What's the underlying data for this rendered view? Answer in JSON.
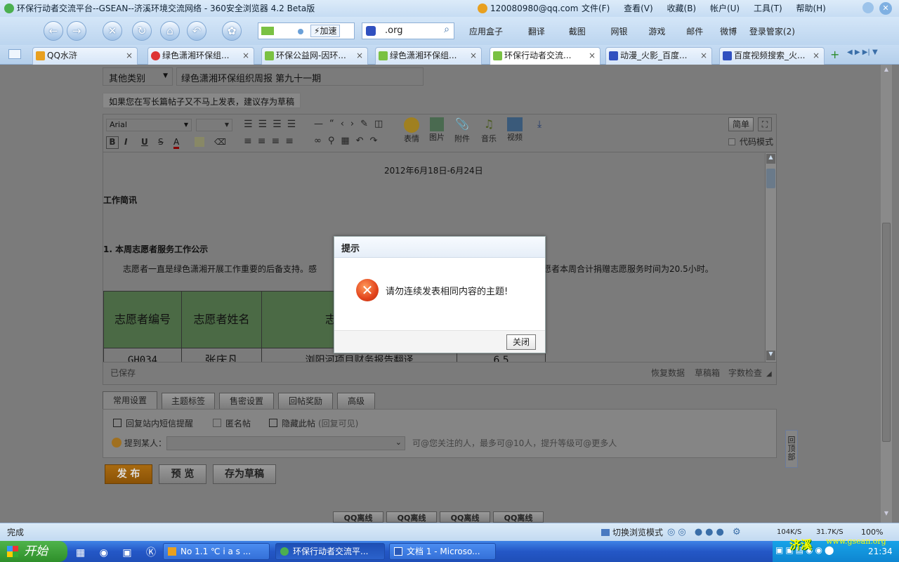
{
  "window": {
    "title": "环保行动者交流平台--GSEAN--济溪环境交流网络 - 360安全浏览器 4.2 Beta版",
    "account": "120080980@qq.com",
    "menu": [
      "文件(F)",
      "查看(V)",
      "收藏(B)",
      "帐户(U)",
      "工具(T)",
      "帮助(H)"
    ]
  },
  "toolbar": {
    "speed_label": "加速",
    "address_value": ".org",
    "links": [
      "应用盒子",
      "翻译",
      "截图",
      "网银",
      "游戏",
      "邮件",
      "微博",
      "登录管家(2)"
    ]
  },
  "tabs": [
    {
      "label": "QQ水浒"
    },
    {
      "label": "绿色潇湘环保组..."
    },
    {
      "label": "环保公益网-因环..."
    },
    {
      "label": "绿色潇湘环保组..."
    },
    {
      "label": "环保行动者交流..."
    },
    {
      "label": "动漫_火影_百度..."
    },
    {
      "label": "百度视频搜索_火..."
    }
  ],
  "form": {
    "category": "其他类别",
    "subject": "绿色潇湘环保组织周报 第九十一期",
    "draft_hint": "如果您在写长篇帖子又不马上发表，建议存为草稿",
    "font": "Arial",
    "editor_tools": {
      "emoji": "表情",
      "image": "图片",
      "attach": "附件",
      "music": "音乐",
      "video": "视频"
    },
    "simple_btn": "简单",
    "code_mode": "代码模式",
    "doc": {
      "date": "2012年6月18日-6月24日",
      "heading": "工作简讯",
      "section": "1. 本周志愿者服务工作公示",
      "para_left": "志愿者一直是绿色潇湘开展工作重要的后备支持。感",
      "para_right": "愿者本周合计捐赠志愿服务时间为20.5小时。",
      "table": {
        "headers": [
          "志愿者编号",
          "志愿者姓名",
          "志"
        ],
        "row": [
          "GH034",
          "张庆凡",
          "浏阳河项目财务报告翻译",
          "6.5"
        ]
      }
    },
    "saved_status": "已保存",
    "editor_footer": [
      "恢复数据",
      "草稿箱",
      "字数检查"
    ],
    "settings_tabs": [
      "常用设置",
      "主题标签",
      "售密设置",
      "回帖奖励",
      "高级"
    ],
    "options": [
      "回复站内短信提醒",
      "匿名帖",
      "隐藏此帖"
    ],
    "option_hint": "(回复可见)",
    "mention_label": "提到某人：",
    "mention_hint": "可@您关注的人，最多可@10人，提升等级可@更多人",
    "buttons": {
      "publish": "发 布",
      "preview": "预 览",
      "save_draft": "存为草稿"
    },
    "back_top": "回顶部",
    "qq_labels": [
      "QQ离线",
      "QQ离线",
      "QQ离线",
      "QQ离线"
    ]
  },
  "modal": {
    "title": "提示",
    "message": "请勿连续发表相同内容的主题!",
    "close": "关闭"
  },
  "status": {
    "left": "完成",
    "switch_mode": "切换浏览模式",
    "down": "104K/S",
    "up": "31.7K/S",
    "zoom": "100%"
  },
  "taskbar": {
    "start": "开始",
    "items": [
      "No 1.1 ℃ i a s ...",
      "环保行动者交流平...",
      "文档 1 - Microso..."
    ],
    "tray_brand": "济溪",
    "tray_url": "www.gsean.org",
    "clock": "21:34"
  }
}
